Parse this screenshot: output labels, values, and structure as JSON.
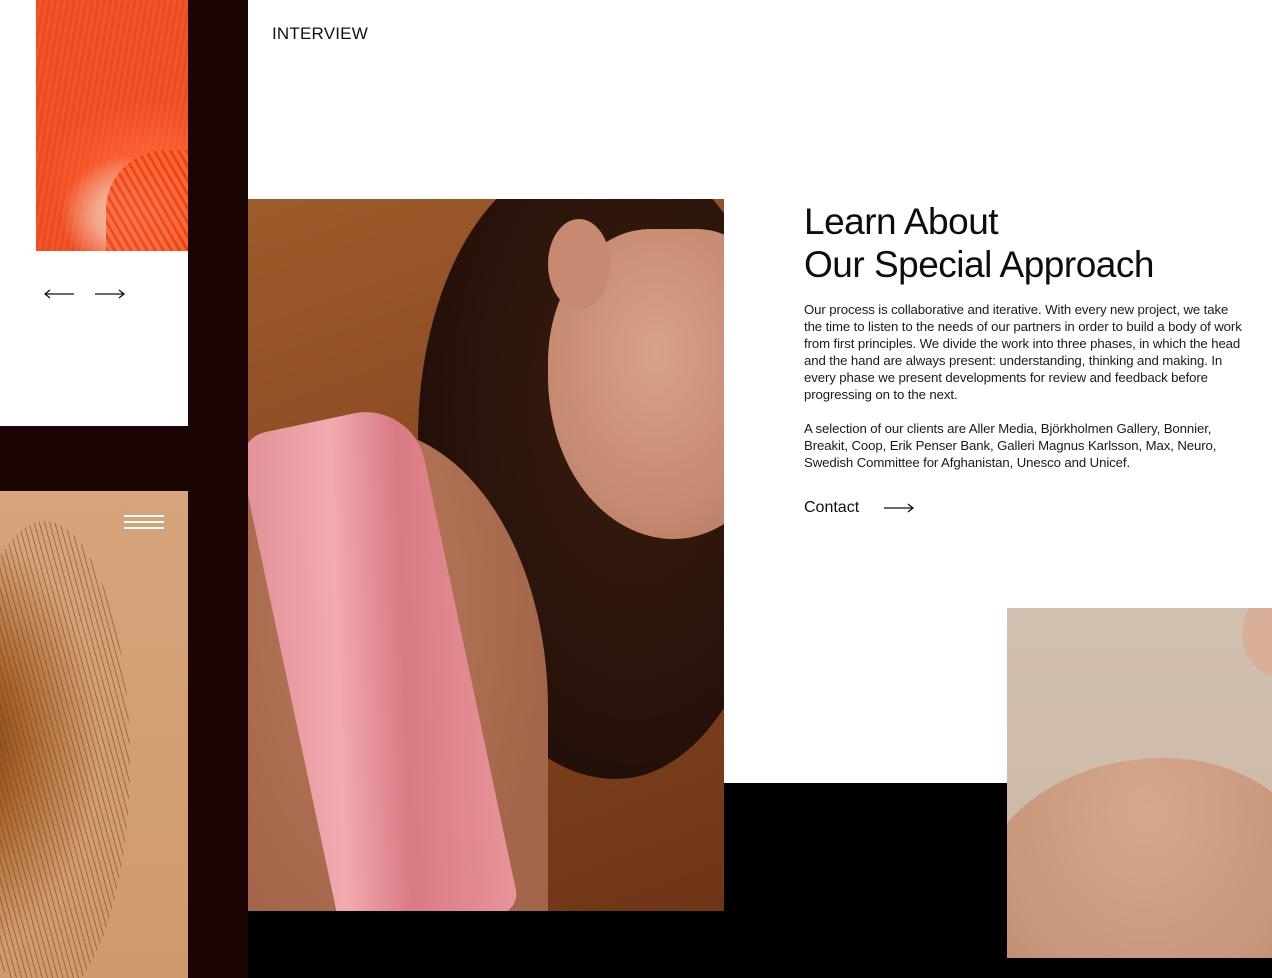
{
  "header": {
    "section_label": "INTERVIEW"
  },
  "slider": {
    "prev_icon": "arrow-left-icon",
    "next_icon": "arrow-right-icon"
  },
  "menu": {
    "icon": "hamburger-menu-icon"
  },
  "content": {
    "heading_line_1": "Learn About",
    "heading_line_2": "Our Special Approach",
    "paragraph_1": "Our process is collaborative and iterative. With every new project, we take the time to listen to the needs of our partners in order to build a body of work from first principles. We divide the work into three phases, in which the head and the hand are always present: understanding, thinking and making. In every phase we present developments for review and feedback before progressing on to the next.",
    "paragraph_2": "A selection of our clients are Aller Media, Björkholmen Gallery, Bonnier, Breakit, Coop, Erik Penser Bank, Galleri Magnus Karlsson, Max, Neuro, Swedish Committee for Afghanistan, Unesco and Unicef.",
    "contact_label": "Contact",
    "contact_icon": "arrow-right-icon"
  },
  "colors": {
    "dark_column": "#1b0504",
    "background": "#ffffff",
    "text": "#111111",
    "bottom_band": "#000000"
  }
}
